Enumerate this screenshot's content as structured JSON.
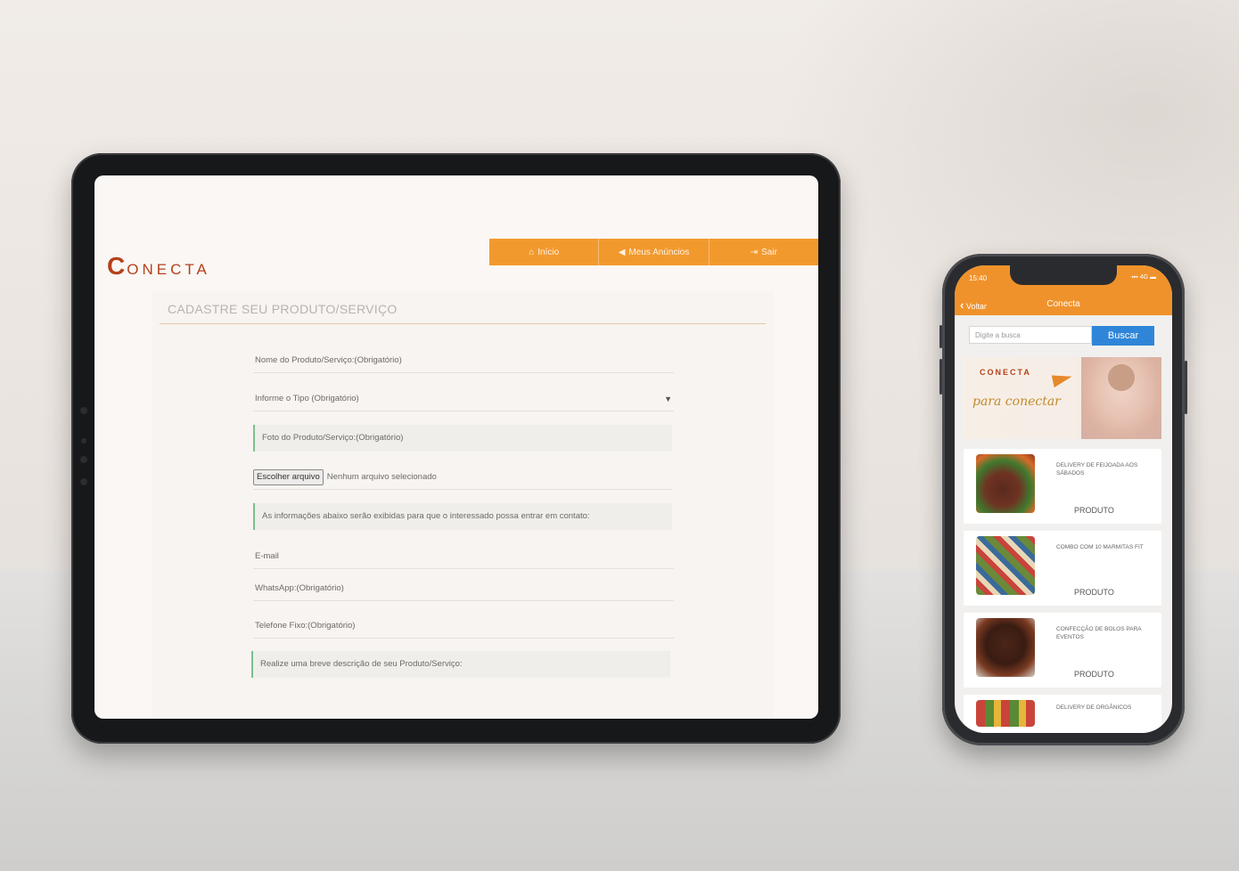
{
  "tablet": {
    "logo_initial": "C",
    "logo_rest": "ONECTA",
    "nav": [
      {
        "icon": "home-icon",
        "glyph": "⌂",
        "label": "Início"
      },
      {
        "icon": "megaphone-icon",
        "glyph": "◀",
        "label": "Meus Anúncios"
      },
      {
        "icon": "exit-icon",
        "glyph": "⇥",
        "label": "Sair"
      }
    ],
    "form": {
      "title": "CADASTRE SEU PRODUTO/SERVIÇO",
      "name_field": "Nome do Produto/Serviço:(Obrigatório)",
      "type_select": "Informe o Tipo (Obrigatório)",
      "photo_label": "Foto do Produto/Serviço:(Obrigatório)",
      "file_button": "Escolher arquivo",
      "file_status": "Nenhum arquivo selecionado",
      "contact_note": "As informações abaixo serão exibidas para que o interessado possa entrar em contato:",
      "email": "E-mail",
      "whatsapp": "WhatsApp:(Obrigatório)",
      "phone": "Telefone Fixo:(Obrigatório)",
      "description": "Realize uma breve descrição de seu Produto/Serviço:"
    }
  },
  "phone": {
    "time": "15:40",
    "status_icons": "▪▪▪ 4G ▬",
    "back_label": "Voltar",
    "app_title": "Conecta",
    "search_placeholder": "Digite a busca",
    "search_button": "Buscar",
    "banner": {
      "logo": "CONECTA",
      "script": "para conectar"
    },
    "cards": [
      {
        "title": "DELIVERY DE FEIJOADA AOS SÁBADOS",
        "tag": "PRODUTO"
      },
      {
        "title": "COMBO COM 10 MARMITAS FIT",
        "tag": "PRODUTO"
      },
      {
        "title": "CONFECÇÃO DE BOLOS PARA EVENTOS",
        "tag": "PRODUTO"
      },
      {
        "title": "DELIVERY DE ORGÂNICOS",
        "tag": ""
      }
    ]
  },
  "colors": {
    "accent_orange": "#f2992e",
    "logo_red": "#b5401a",
    "search_blue": "#2f86d8",
    "note_border_green": "#7bbf8e"
  }
}
